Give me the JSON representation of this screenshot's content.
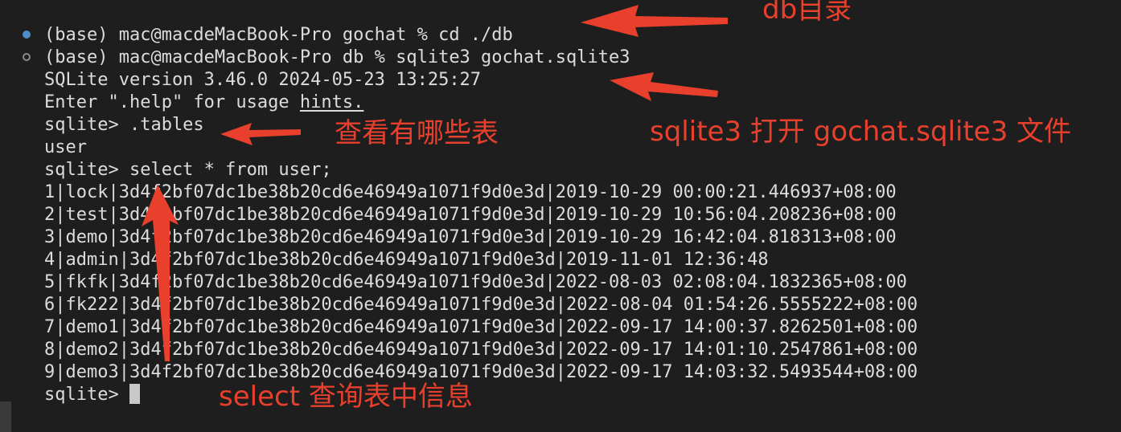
{
  "terminal": {
    "lines": [
      "(base) mac@macdeMacBook-Pro gochat % cd ./db",
      "(base) mac@macdeMacBook-Pro db % sqlite3 gochat.sqlite3",
      "SQLite version 3.46.0 2024-05-23 13:25:27",
      "Enter \".help\" for usage ",
      "hints.",
      "sqlite> .tables",
      "user",
      "sqlite> select * from user;",
      "1|lock|3d4f2bf07dc1be38b20cd6e46949a1071f9d0e3d|2019-10-29 00:00:21.446937+08:00",
      "2|test|3d4f2bf07dc1be38b20cd6e46949a1071f9d0e3d|2019-10-29 10:56:04.208236+08:00",
      "3|demo|3d4f2bf07dc1be38b20cd6e46949a1071f9d0e3d|2019-10-29 16:42:04.818313+08:00",
      "4|admin|3d4f2bf07dc1be38b20cd6e46949a1071f9d0e3d|2019-11-01 12:36:48",
      "5|fkfk|3d4f2bf07dc1be38b20cd6e46949a1071f9d0e3d|2022-08-03 02:08:04.1832365+08:00",
      "6|fk222|3d4f2bf07dc1be38b20cd6e46949a1071f9d0e3d|2022-08-04 01:54:26.5555222+08:00",
      "7|demo1|3d4f2bf07dc1be38b20cd6e46949a1071f9d0e3d|2022-09-17 14:00:37.8262501+08:00",
      "8|demo2|3d4f2bf07dc1be38b20cd6e46949a1071f9d0e3d|2022-09-17 14:01:10.2547861+08:00",
      "9|demo3|3d4f2bf07dc1be38b20cd6e46949a1071f9d0e3d|2022-09-17 14:03:32.5493544+08:00",
      "sqlite> "
    ]
  },
  "annotations": {
    "db_dir": "db目录",
    "open_file": "sqlite3 打开 gochat.sqlite3 文件",
    "view_tables": "查看有哪些表",
    "select_query": "select 查询表中信息"
  },
  "colors": {
    "background": "#1e1e1e",
    "text": "#dcdcdc",
    "annotation": "#e8402d",
    "dot_active": "#4d8fc6"
  }
}
